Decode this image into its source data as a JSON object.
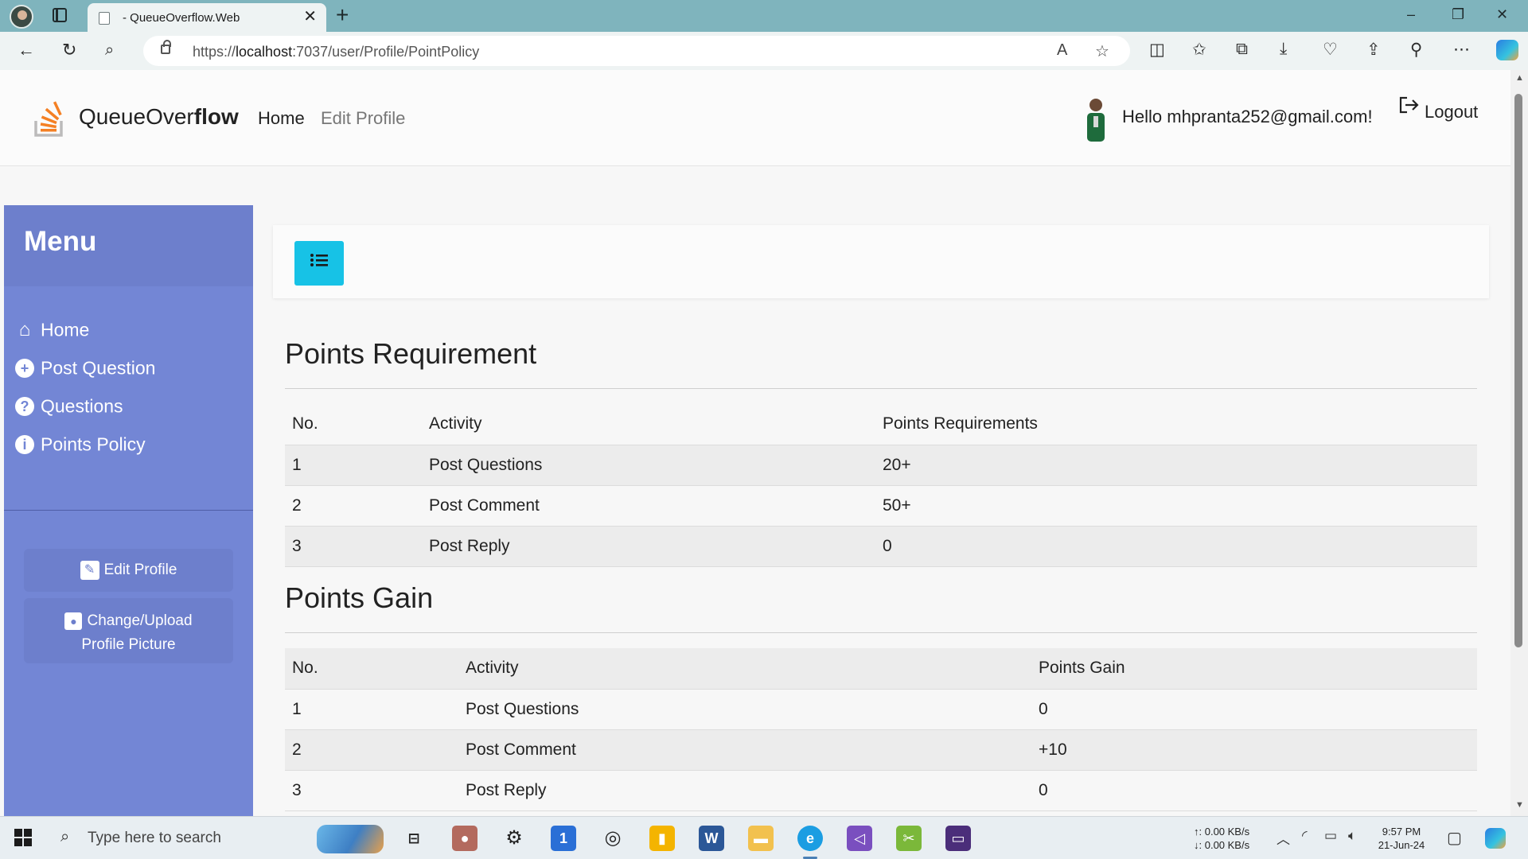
{
  "browser": {
    "tab_title": "- QueueOverflow.Web",
    "url_prefix": "https://",
    "url_host": "localhost",
    "url_path": ":7037/user/Profile/PointPolicy",
    "window_controls": [
      "–",
      "❐",
      "✕"
    ]
  },
  "header": {
    "brand_regular": "QueueOver",
    "brand_bold": "flow",
    "nav": {
      "home": "Home",
      "edit_profile": "Edit Profile"
    },
    "greeting": "Hello mhpranta252@gmail.com!",
    "logout": "Logout"
  },
  "sidebar": {
    "title": "Menu",
    "items": [
      {
        "label": "Home",
        "icon": "home-icon"
      },
      {
        "label": "Post Question",
        "icon": "plus-circle-icon"
      },
      {
        "label": "Questions",
        "icon": "question-circle-icon"
      },
      {
        "label": "Points Policy",
        "icon": "info-circle-icon"
      }
    ],
    "buttons": {
      "edit_profile": "Edit Profile",
      "change_picture_line1": "Change/Upload",
      "change_picture_line2": "Profile Picture"
    }
  },
  "requirements": {
    "title": "Points Requirement",
    "headers": [
      "No.",
      "Activity",
      "Points Requirements"
    ],
    "rows": [
      [
        "1",
        "Post Questions",
        "20+"
      ],
      [
        "2",
        "Post Comment",
        "50+"
      ],
      [
        "3",
        "Post Reply",
        "0"
      ]
    ]
  },
  "gain": {
    "title": "Points Gain",
    "headers": [
      "No.",
      "Activity",
      "Points Gain"
    ],
    "rows": [
      [
        "1",
        "Post Questions",
        "0"
      ],
      [
        "2",
        "Post Comment",
        "+10"
      ],
      [
        "3",
        "Post Reply",
        "0"
      ]
    ]
  },
  "taskbar": {
    "search_placeholder": "Type here to search",
    "net_up": "↑: 0.00 KB/s",
    "net_down": "↓: 0.00 KB/s",
    "time": "9:57 PM",
    "date": "21-Jun-24"
  },
  "colors": {
    "sidebar": "#7386d5",
    "sidebar_dark": "#6d7fcc",
    "toggle_button": "#17c2e6",
    "browser_frame": "#7fb4bd"
  }
}
